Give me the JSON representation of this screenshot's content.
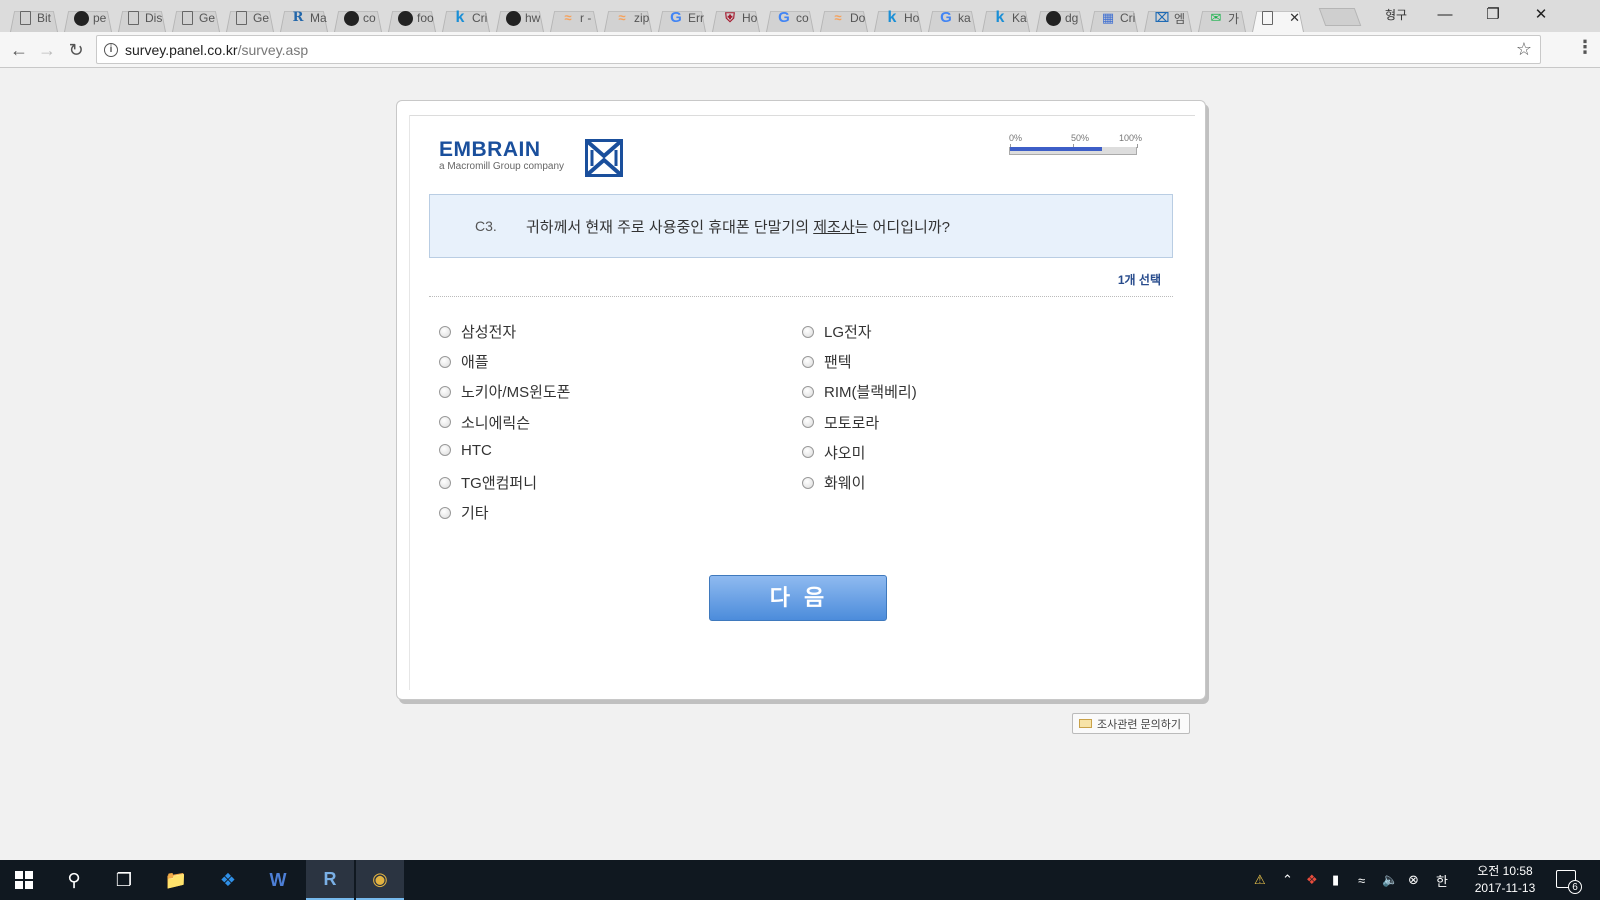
{
  "browser": {
    "tabs": [
      {
        "icon": "page-icon",
        "title": "Bit"
      },
      {
        "icon": "github-icon",
        "title": "pe"
      },
      {
        "icon": "page-icon",
        "title": "Dis"
      },
      {
        "icon": "page-icon",
        "title": "Ge"
      },
      {
        "icon": "page-icon",
        "title": "Ge"
      },
      {
        "icon": "r-icon",
        "title": "Ma"
      },
      {
        "icon": "github-icon",
        "title": "co"
      },
      {
        "icon": "github-icon",
        "title": "foo"
      },
      {
        "icon": "k-icon",
        "title": "Cri"
      },
      {
        "icon": "github-icon",
        "title": "hw"
      },
      {
        "icon": "stackoverflow-icon",
        "title": "r -"
      },
      {
        "icon": "stackoverflow-icon",
        "title": "zip"
      },
      {
        "icon": "google-icon",
        "title": "Err"
      },
      {
        "icon": "harvard-icon",
        "title": "Ho"
      },
      {
        "icon": "google-icon",
        "title": "co"
      },
      {
        "icon": "stackoverflow-icon",
        "title": "Do"
      },
      {
        "icon": "k-icon",
        "title": "Ho"
      },
      {
        "icon": "google-icon",
        "title": "ka"
      },
      {
        "icon": "k-icon",
        "title": "Ka"
      },
      {
        "icon": "github-icon",
        "title": "dg"
      },
      {
        "icon": "calendar-icon",
        "title": "Cri"
      },
      {
        "icon": "embrain-icon",
        "title": "엠"
      },
      {
        "icon": "mail-icon",
        "title": "가"
      },
      {
        "icon": "page-icon",
        "title": "",
        "active": true
      }
    ],
    "profile_name": "형구",
    "url_host": "survey.panel.co.kr",
    "url_path": "/survey.asp"
  },
  "survey": {
    "logo_text": "EMBRAIN",
    "logo_subtitle": "a Macromill Group company",
    "progress": {
      "ticks": [
        "0%",
        "50%",
        "100%"
      ],
      "fraction": 0.72
    },
    "question_number": "C3.",
    "question_before": "귀하께서 현재 주로 사용중인 휴대폰 단말기의 ",
    "question_underlined": "제조사",
    "question_after": "는 어디입니까?",
    "select_note": "1개 선택",
    "options_left": [
      "삼성전자",
      "애플",
      "노키아/MS윈도폰",
      "소니에릭슨",
      "HTC",
      "TG앤컴퍼니",
      "기타"
    ],
    "options_right": [
      "LG전자",
      "팬텍",
      "RIM(블랙베리)",
      "모토로라",
      "샤오미",
      "화웨이"
    ],
    "next_label": "다음",
    "inquiry_label": "조사관련 문의하기"
  },
  "taskbar": {
    "clock_ampm": "오전 10:58",
    "clock_date": "2017-11-13",
    "ime": "한",
    "notification_count": "6"
  },
  "colors": {
    "brand": "#1a4f9c",
    "question_bg": "#e8f1fb",
    "progress_fill": "#3d5ec7",
    "button": "#4c8cdb"
  }
}
